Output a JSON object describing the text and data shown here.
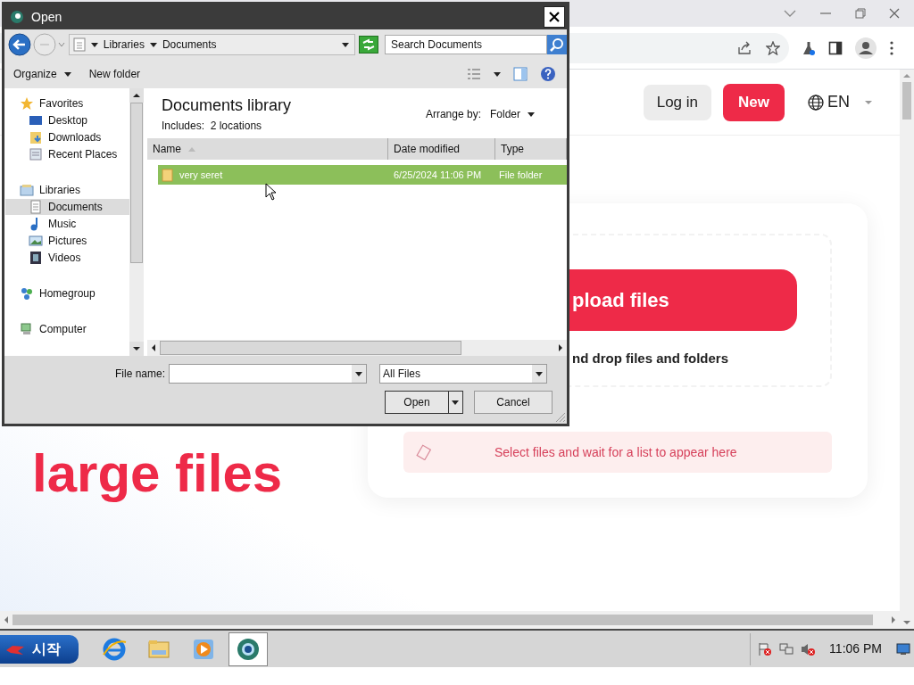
{
  "header": {
    "login": "Log in",
    "new": "New",
    "language": "EN"
  },
  "hero": [
    {
      "text": "large files",
      "kind": "accent"
    }
  ],
  "uploader": {
    "button": "pload files",
    "hint": "nd drop files and folders",
    "empty_message": "Select files and wait for a list to appear here"
  },
  "dialog": {
    "title": "Open",
    "breadcrumb": [
      "Libraries",
      "Documents"
    ],
    "search_placeholder": "Search Documents",
    "commands": [
      "Organize",
      "New folder"
    ],
    "nav": [
      {
        "label": "Favorites",
        "kind": "star",
        "selected": false,
        "children": [
          {
            "label": "Desktop",
            "kind": "desktop",
            "selected": false
          },
          {
            "label": "Downloads",
            "kind": "folder",
            "selected": false
          },
          {
            "label": "Recent Places",
            "kind": "recent",
            "selected": false
          }
        ]
      },
      {
        "label": "Libraries",
        "kind": "library",
        "selected": false,
        "children": [
          {
            "label": "Documents",
            "kind": "document",
            "selected": true
          },
          {
            "label": "Music",
            "kind": "music",
            "selected": false
          },
          {
            "label": "Pictures",
            "kind": "pictures",
            "selected": false
          },
          {
            "label": "Videos",
            "kind": "videos",
            "selected": false
          }
        ]
      },
      {
        "label": "Homegroup",
        "kind": "homegroup",
        "selected": false
      },
      {
        "label": "Computer",
        "kind": "computer",
        "selected": false
      }
    ],
    "library_title": "Documents library",
    "includes": "Includes:  2 locations",
    "arrange_label": "Arrange by:",
    "arrange_value": "Folder",
    "columns": [
      "Name",
      "Date modified",
      "Type"
    ],
    "files": [
      {
        "name": "very seret",
        "date": "6/25/2024 11:06 PM",
        "type": "File folder",
        "selected": true
      }
    ],
    "file_name_label": "File name:",
    "file_type": "All Files",
    "buttons": [
      "Open",
      "Cancel"
    ]
  },
  "taskbar": {
    "start": "시작",
    "apps": [
      {
        "kind": "browser-e",
        "selected": false
      },
      {
        "kind": "folder",
        "selected": false
      },
      {
        "kind": "player",
        "selected": false
      },
      {
        "kind": "orb",
        "selected": true
      }
    ],
    "clock": "11:06 PM"
  }
}
